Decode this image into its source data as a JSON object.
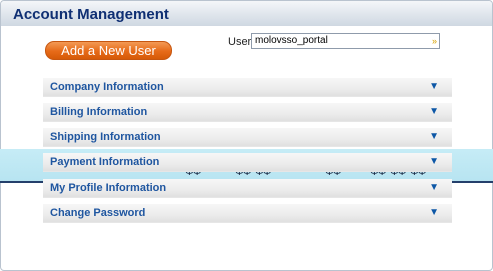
{
  "header": {
    "title": "Account Management"
  },
  "toolbar": {
    "add_user_label": "Add a New User"
  },
  "user_select": {
    "label": "User",
    "value": "molovsso_portal",
    "dropdown_glyph": "»"
  },
  "sections": [
    {
      "label": "Company Information",
      "arrow": "▼"
    },
    {
      "label": "Billing Information",
      "arrow": "▼"
    },
    {
      "label": "Shipping Information",
      "arrow": "▼"
    },
    {
      "label": "Payment Information",
      "arrow": "▼"
    },
    {
      "label": "My Profile Information",
      "arrow": "▼"
    },
    {
      "label": "Change Password",
      "arrow": "▼"
    }
  ],
  "banner": {
    "icon": "bicycle-icon",
    "glyph": "ΦΦ"
  },
  "colors": {
    "title_text": "#0f2f73",
    "add_button": "#e66a18",
    "section_label": "#1f56a0",
    "banner": "#b7e4f1",
    "banner_line": "#243f6b"
  }
}
